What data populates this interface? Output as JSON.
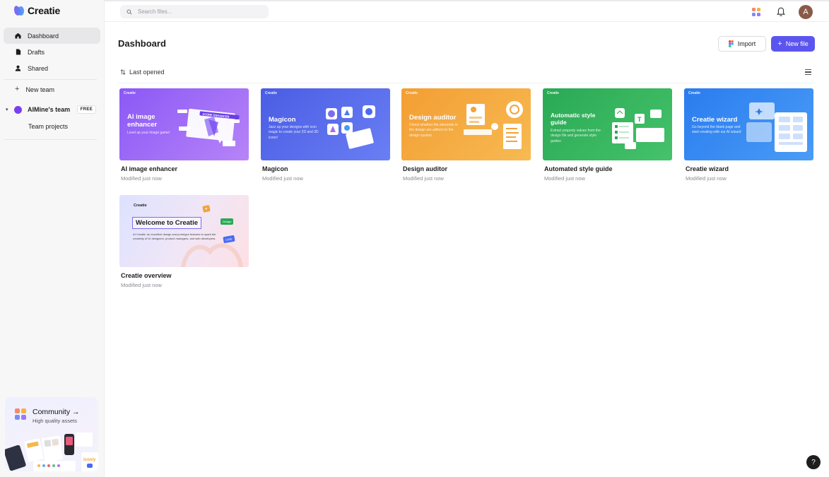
{
  "app": {
    "name": "Creatie"
  },
  "sidebar": {
    "items": [
      {
        "label": "Dashboard",
        "icon": "home-icon",
        "active": true
      },
      {
        "label": "Drafts",
        "icon": "file-icon",
        "active": false
      },
      {
        "label": "Shared",
        "icon": "user-icon",
        "active": false
      }
    ],
    "new_team": "New team",
    "team": {
      "name": "AIMine's team",
      "badge": "FREE",
      "color": "#7a3ff0"
    },
    "team_projects": "Team projects",
    "community": {
      "title": "Community →",
      "subtitle": "High quality assets",
      "brand_mark": "iconiy"
    }
  },
  "topbar": {
    "search_placeholder": "Search files...",
    "avatar_initial": "A"
  },
  "main": {
    "title": "Dashboard",
    "import_label": "Import",
    "new_file_label": "New file",
    "sort_label": "Last opened"
  },
  "files": [
    {
      "name": "AI image enhancer",
      "modified": "Modified just now",
      "thumb_title": "AI image enhancer",
      "thumb_desc": "Level up your image game!",
      "thumb_label": "SCORE ENHANCER",
      "color_from": "#8e5cf7",
      "color_to": "#b07cf7"
    },
    {
      "name": "Magicon",
      "modified": "Modified just now",
      "thumb_title": "Magicon",
      "thumb_desc": "Jazz up your designs with icon magic to create your 2D and 3D icons!",
      "color_from": "#4e63e6",
      "color_to": "#6c7ef3"
    },
    {
      "name": "Design auditor",
      "modified": "Modified just now",
      "thumb_title": "Design auditor",
      "thumb_desc": "Check whether the elements in the design are adhere to the design system",
      "color_from": "#f5a23a",
      "color_to": "#f7bb55"
    },
    {
      "name": "Automated style guide",
      "modified": "Modified just now",
      "thumb_title": "Automatic style guide",
      "thumb_desc": "Extract property values from the design file and generate style guides",
      "color_from": "#2fae5a",
      "color_to": "#46c36b"
    },
    {
      "name": "Creatie wizard",
      "modified": "Modified just now",
      "thumb_title": "Creatie wizard",
      "thumb_desc": "Go beyond the blank page and start creating with our AI wizard",
      "color_from": "#2c7ff0",
      "color_to": "#4a9af6"
    },
    {
      "name": "Creatie overview",
      "modified": "Modified just now",
      "thumb_title": "Welcome to Creatie",
      "thumb_desc": "AI Creatie: an excellent design and prototype features to spark the creativity of UI designers, product managers, and web developers.",
      "tags": [
        "Design",
        "Code"
      ],
      "color_from": "#dfe3ff",
      "color_to": "#fde1e6"
    }
  ],
  "help_label": "?"
}
